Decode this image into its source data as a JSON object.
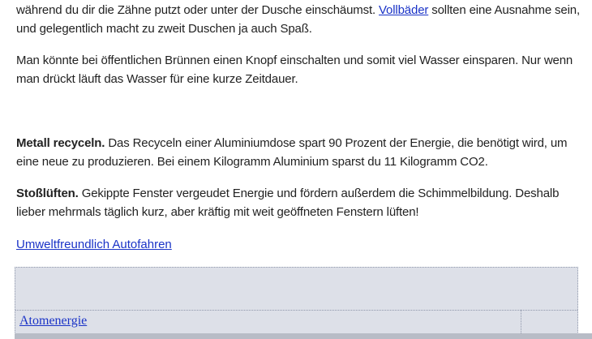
{
  "paragraphs": {
    "p1": {
      "before_link": "während du dir die Zähne putzt oder unter der Dusche einschäumst. ",
      "link_text": "Vollbäder",
      "after_link": " sollten eine Ausnahme sein, und gelegentlich macht zu zweit Duschen ja auch Spaß."
    },
    "p2": {
      "text": "Man könnte bei öffentlichen Brünnen einen Knopf einschalten und somit viel Wasser einsparen. Nur wenn man drückt läuft das Wasser für eine kurze Zeitdauer."
    },
    "p3": {
      "bold": "Metall recyceln.",
      "text": " Das Recyceln einer Aluminiumdose spart 90  Prozent der Energie, die benötigt wird, um eine neue zu produzieren. Bei einem Kilogramm Aluminium sparst du 11  Kilogramm CO2."
    },
    "p4": {
      "bold": "Stoßlüften.",
      "text": " Gekippte Fenster vergeudet Energie und fördern außerdem die Schimmelbildung. Deshalb lieber mehrmals täglich kurz, aber kräftig mit weit geöffneten Fenstern lüften!"
    }
  },
  "links": {
    "autofahren": "Umweltfreundlich Autofahren",
    "atomenergie": "Atomenergie"
  },
  "colors": {
    "link": "#1a33c7",
    "table_background": "#dde0e8"
  }
}
